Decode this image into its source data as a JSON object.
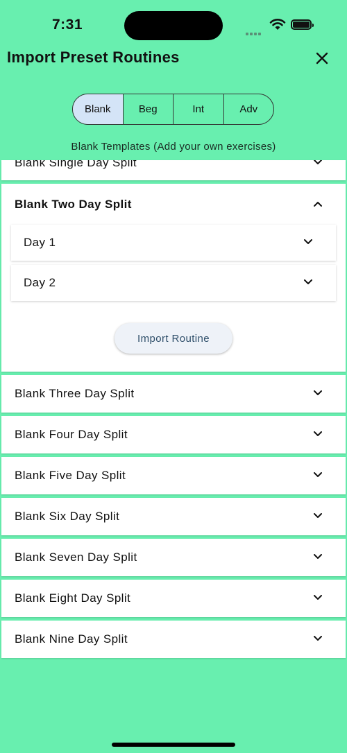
{
  "status": {
    "time": "7:31"
  },
  "header": {
    "title": "Import Preset Routines",
    "close_icon": "close-icon"
  },
  "tabs": [
    {
      "label": "Blank",
      "active": true
    },
    {
      "label": "Beg",
      "active": false
    },
    {
      "label": "Int",
      "active": false
    },
    {
      "label": "Adv",
      "active": false
    }
  ],
  "subtitle": "Blank Templates (Add your own exercises)",
  "routines": {
    "partial_item": "Blank Single Day Split",
    "expanded": {
      "title": "Blank Two Day Split",
      "days": [
        "Day 1",
        "Day 2"
      ],
      "import_label": "Import Routine"
    },
    "items": [
      "Blank Three Day Split",
      "Blank Four Day Split",
      "Blank Five Day Split",
      "Blank Six Day Split",
      "Blank Seven Day Split",
      "Blank Eight Day Split",
      "Blank Nine Day Split"
    ]
  },
  "colors": {
    "background": "#68efaf",
    "active_tab": "#d4e4f7",
    "button_text": "#2f4f6a"
  }
}
